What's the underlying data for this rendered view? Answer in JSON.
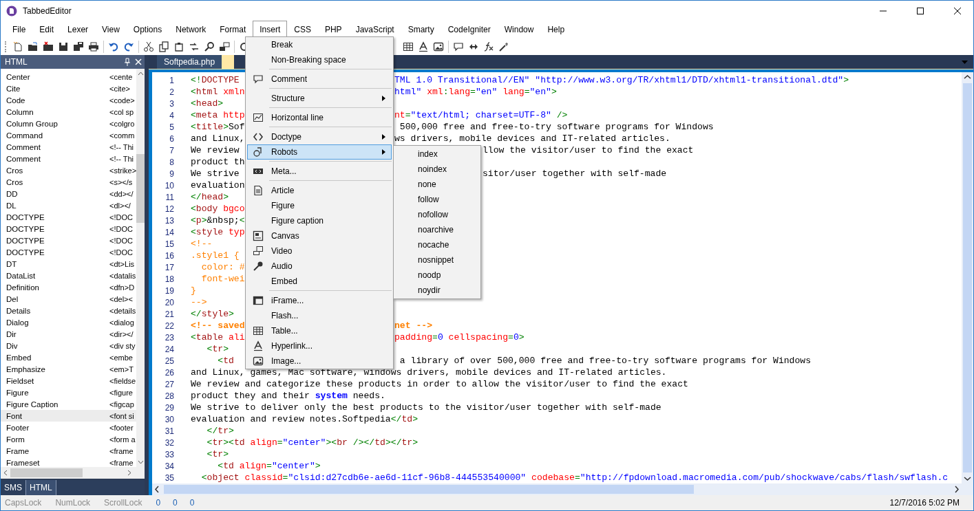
{
  "window": {
    "title": "TabbedEditor"
  },
  "menu_bar": [
    {
      "label": "File",
      "selected": false
    },
    {
      "label": "Edit",
      "selected": false
    },
    {
      "label": "Lexer",
      "selected": false
    },
    {
      "label": "View",
      "selected": false
    },
    {
      "label": "Options",
      "selected": false
    },
    {
      "label": "Network",
      "selected": false
    },
    {
      "label": "Format",
      "selected": false
    },
    {
      "label": "Insert",
      "selected": true
    },
    {
      "label": "CSS",
      "selected": false
    },
    {
      "label": "PHP",
      "selected": false
    },
    {
      "label": "JavaScript",
      "selected": false
    },
    {
      "label": "Smarty",
      "selected": false
    },
    {
      "label": "CodeIgniter",
      "selected": false
    },
    {
      "label": "Window",
      "selected": false
    },
    {
      "label": "Help",
      "selected": false
    }
  ],
  "insert_menu": [
    {
      "kind": "item",
      "label": "Break",
      "selected": false
    },
    {
      "kind": "item",
      "label": "Non-Breaking space",
      "selected": false
    },
    {
      "kind": "separator"
    },
    {
      "kind": "item",
      "label": "Comment",
      "selected": false
    },
    {
      "kind": "separator"
    },
    {
      "kind": "item",
      "label": "Structure",
      "has_submenu": true,
      "selected": false
    },
    {
      "kind": "separator"
    },
    {
      "kind": "item",
      "label": "Horizontal line",
      "selected": false
    },
    {
      "kind": "separator"
    },
    {
      "kind": "item",
      "label": "Doctype",
      "has_submenu": true,
      "selected": false
    },
    {
      "kind": "item",
      "label": "Robots",
      "has_submenu": true,
      "selected": true,
      "submenu": [
        "index",
        "noindex",
        "none",
        "follow",
        "nofollow",
        "noarchive",
        "nocache",
        "nosnippet",
        "noodp",
        "noydir"
      ]
    },
    {
      "kind": "separator"
    },
    {
      "kind": "item",
      "label": "Meta...",
      "selected": false
    },
    {
      "kind": "separator"
    },
    {
      "kind": "item",
      "label": "Article",
      "selected": false
    },
    {
      "kind": "item",
      "label": "Figure",
      "selected": false
    },
    {
      "kind": "item",
      "label": "Figure caption",
      "selected": false
    },
    {
      "kind": "item",
      "label": "Canvas",
      "selected": false
    },
    {
      "kind": "item",
      "label": "Video",
      "selected": false
    },
    {
      "kind": "item",
      "label": "Audio",
      "selected": false
    },
    {
      "kind": "item",
      "label": "Embed",
      "selected": false
    },
    {
      "kind": "separator"
    },
    {
      "kind": "item",
      "label": "iFrame...",
      "selected": false
    },
    {
      "kind": "item",
      "label": "Flash...",
      "selected": false
    },
    {
      "kind": "item",
      "label": "Table...",
      "selected": false
    },
    {
      "kind": "item",
      "label": "Hyperlink...",
      "selected": false
    },
    {
      "kind": "item",
      "label": "Image...",
      "selected": false
    }
  ],
  "side_panel": {
    "title": "HTML",
    "items": [
      {
        "name": "Center",
        "snippet": "<cente",
        "selected": false
      },
      {
        "name": "Cite",
        "snippet": "<cite>",
        "selected": false
      },
      {
        "name": "Code",
        "snippet": "<code>",
        "selected": false
      },
      {
        "name": "Column",
        "snippet": "<col sp",
        "selected": false
      },
      {
        "name": "Column Group",
        "snippet": "<colgro",
        "selected": false
      },
      {
        "name": "Command",
        "snippet": "<comm",
        "selected": false
      },
      {
        "name": "Comment",
        "snippet": "<!-- Thi",
        "selected": false
      },
      {
        "name": "Comment",
        "snippet": "<!-- Thi",
        "selected": false
      },
      {
        "name": "Cros",
        "snippet": "<strike>",
        "selected": false
      },
      {
        "name": "Cros",
        "snippet": "<s></s",
        "selected": false
      },
      {
        "name": "DD",
        "snippet": "<dd></",
        "selected": false
      },
      {
        "name": "DL",
        "snippet": "<dl></",
        "selected": false
      },
      {
        "name": "DOCTYPE",
        "snippet": "<!DOC",
        "selected": false
      },
      {
        "name": "DOCTYPE",
        "snippet": "<!DOC",
        "selected": false
      },
      {
        "name": "DOCTYPE",
        "snippet": "<!DOC",
        "selected": false
      },
      {
        "name": "DOCTYPE",
        "snippet": "<!DOC",
        "selected": false
      },
      {
        "name": "DT",
        "snippet": "<dt>Lis",
        "selected": false
      },
      {
        "name": "DataList",
        "snippet": "<datalis",
        "selected": false
      },
      {
        "name": "Definition",
        "snippet": "<dfn>D",
        "selected": false
      },
      {
        "name": "Del",
        "snippet": "<del><",
        "selected": false
      },
      {
        "name": "Details",
        "snippet": "<details",
        "selected": false
      },
      {
        "name": "Dialog",
        "snippet": "<dialog",
        "selected": false
      },
      {
        "name": "Dir",
        "snippet": "<dir></",
        "selected": false
      },
      {
        "name": "Div",
        "snippet": "<div sty",
        "selected": false
      },
      {
        "name": "Embed",
        "snippet": "<embe",
        "selected": false
      },
      {
        "name": "Emphasize",
        "snippet": "<em>T",
        "selected": false
      },
      {
        "name": "Fieldset",
        "snippet": "<fieldse",
        "selected": false
      },
      {
        "name": "Figure",
        "snippet": "<figure",
        "selected": false
      },
      {
        "name": "Figure Caption",
        "snippet": "<figcap",
        "selected": false
      },
      {
        "name": "Font",
        "snippet": "<font si",
        "selected": true
      },
      {
        "name": "Footer",
        "snippet": "<footer",
        "selected": false
      },
      {
        "name": "Form",
        "snippet": "<form a",
        "selected": false
      },
      {
        "name": "Frame",
        "snippet": "<frame",
        "selected": false
      },
      {
        "name": "Frameset",
        "snippet": "<frame",
        "selected": false
      }
    ],
    "bottom_tabs": [
      {
        "label": "SMS",
        "selected": false
      },
      {
        "label": "HTML",
        "selected": true
      }
    ]
  },
  "editor": {
    "tabs": [
      {
        "label": "Softpedia.php",
        "selected": false
      }
    ],
    "lines": [
      {
        "n": "1",
        "text": [
          {
            "kind": "punct",
            "text": "<!"
          },
          {
            "kind": "tag",
            "text": "DOCTYPE"
          }
        ],
        "after_menu": [
          {
            "kind": "value",
            "text": "TML 1.0 Transitional//EN\" \"http://www.w3.org/TR/xhtml1/DTD/xhtml1-transitional.dtd\""
          },
          {
            "kind": "punct",
            "text": ">"
          }
        ]
      },
      {
        "n": "2",
        "text": [
          {
            "kind": "punct",
            "text": "<"
          },
          {
            "kind": "tag",
            "text": "html"
          },
          {
            "kind": "attr",
            "text": " xmln"
          }
        ],
        "after_menu": [
          {
            "kind": "value",
            "text": "html\""
          },
          {
            "kind": "attr",
            "text": " xml"
          },
          {
            "kind": "punct",
            "text": ":"
          },
          {
            "kind": "attr",
            "text": "lang"
          },
          {
            "kind": "punct",
            "text": "="
          },
          {
            "kind": "value",
            "text": "\"en\""
          },
          {
            "kind": "attr",
            "text": " lang"
          },
          {
            "kind": "punct",
            "text": "="
          },
          {
            "kind": "value",
            "text": "\"en\""
          },
          {
            "kind": "punct",
            "text": ">"
          }
        ]
      },
      {
        "n": "3",
        "text": [
          {
            "kind": "punct",
            "text": "<"
          },
          {
            "kind": "tag",
            "text": "head"
          },
          {
            "kind": "punct",
            "text": ">"
          }
        ]
      },
      {
        "n": "4",
        "text": [
          {
            "kind": "punct",
            "text": "<"
          },
          {
            "kind": "tag",
            "text": "meta"
          },
          {
            "kind": "attr",
            "text": " http"
          }
        ],
        "after_menu": [
          {
            "kind": "attr",
            "text": "nt"
          },
          {
            "kind": "punct",
            "text": "="
          },
          {
            "kind": "value",
            "text": "\"text/html; charset=UTF-8\""
          },
          {
            "kind": "punct",
            "text": " />"
          }
        ]
      },
      {
        "n": "5",
        "text": [
          {
            "kind": "punct",
            "text": "<"
          },
          {
            "kind": "tag",
            "text": "title"
          },
          {
            "kind": "punct",
            "text": ">"
          },
          {
            "kind": "plain",
            "text": "Sof"
          }
        ],
        "after_menu": [
          {
            "kind": "plain",
            "text": " 500,000 free and free-to-try software programs for Windows"
          }
        ]
      },
      {
        "n": "6",
        "text": [
          {
            "kind": "plain",
            "text": "and Linux,"
          }
        ],
        "after_menu": [
          {
            "kind": "plain",
            "text": "ws drivers, mobile devices and IT-related articles."
          }
        ]
      },
      {
        "n": "7",
        "text": [
          {
            "kind": "plain",
            "text": "We review"
          }
        ],
        "after_submenu": [
          {
            "kind": "plain",
            "text": "llow the visitor/user to find the exact"
          }
        ]
      },
      {
        "n": "8",
        "text": [
          {
            "kind": "plain",
            "text": "product th"
          }
        ]
      },
      {
        "n": "9",
        "text": [
          {
            "kind": "plain",
            "text": "We strive"
          }
        ],
        "after_submenu": [
          {
            "kind": "plain",
            "text": "sitor/user together with self-made"
          }
        ]
      },
      {
        "n": "10",
        "text": [
          {
            "kind": "plain",
            "text": "evaluation"
          }
        ]
      },
      {
        "n": "11",
        "text": [
          {
            "kind": "punct",
            "text": "</"
          },
          {
            "kind": "tag",
            "text": "head"
          },
          {
            "kind": "punct",
            "text": ">"
          }
        ]
      },
      {
        "n": "12",
        "text": [
          {
            "kind": "punct",
            "text": "<"
          },
          {
            "kind": "tag",
            "text": "body"
          },
          {
            "kind": "attr",
            "text": " bgco"
          }
        ]
      },
      {
        "n": "13",
        "text": [
          {
            "kind": "punct",
            "text": "<"
          },
          {
            "kind": "tag",
            "text": "p"
          },
          {
            "kind": "punct",
            "text": ">"
          },
          {
            "kind": "plain",
            "text": "&nbsp;"
          },
          {
            "kind": "punct",
            "text": "<"
          }
        ]
      },
      {
        "n": "14",
        "text": [
          {
            "kind": "punct",
            "text": "<"
          },
          {
            "kind": "tag",
            "text": "style"
          },
          {
            "kind": "attr",
            "text": " typ"
          }
        ]
      },
      {
        "n": "15",
        "text": [
          {
            "kind": "comment",
            "text": "<!--"
          }
        ]
      },
      {
        "n": "16",
        "text": [
          {
            "kind": "comment",
            "text": ".style1 {"
          }
        ]
      },
      {
        "n": "17",
        "text": [
          {
            "kind": "comment",
            "text": "  color: #"
          }
        ]
      },
      {
        "n": "18",
        "text": [
          {
            "kind": "comment",
            "text": "  font-wei"
          }
        ]
      },
      {
        "n": "19",
        "text": [
          {
            "kind": "comment",
            "text": "}"
          }
        ]
      },
      {
        "n": "20",
        "text": [
          {
            "kind": "comment",
            "text": "-->"
          }
        ]
      },
      {
        "n": "21",
        "text": [
          {
            "kind": "punct",
            "text": "</"
          },
          {
            "kind": "tag",
            "text": "style"
          },
          {
            "kind": "punct",
            "text": ">"
          }
        ]
      },
      {
        "n": "22",
        "text": [
          {
            "kind": "comment_bold",
            "text": "<!-- saved"
          }
        ],
        "after_menu": [
          {
            "kind": "comment_bold",
            "text": "net -->"
          }
        ]
      },
      {
        "n": "23",
        "text": [
          {
            "kind": "punct",
            "text": "<"
          },
          {
            "kind": "tag",
            "text": "table"
          },
          {
            "kind": "attr",
            "text": " ali"
          }
        ],
        "after_menu": [
          {
            "kind": "attr",
            "text": "padding"
          },
          {
            "kind": "punct",
            "text": "="
          },
          {
            "kind": "value",
            "text": "0"
          },
          {
            "kind": "attr",
            "text": " cellspacing"
          },
          {
            "kind": "punct",
            "text": "="
          },
          {
            "kind": "value",
            "text": "0"
          },
          {
            "kind": "punct",
            "text": ">"
          }
        ]
      },
      {
        "n": "24",
        "text": [
          {
            "kind": "punct",
            "text": "   <"
          },
          {
            "kind": "tag",
            "text": "tr"
          },
          {
            "kind": "punct",
            "text": ">"
          }
        ]
      },
      {
        "n": "25",
        "text": [
          {
            "kind": "punct",
            "text": "     <"
          },
          {
            "kind": "tag",
            "text": "td"
          }
        ],
        "after_menu": [
          {
            "kind": "plain",
            "text": " a library of over 500,000 free and free-to-try software programs for Windows"
          }
        ]
      },
      {
        "n": "26",
        "text": [
          {
            "kind": "plain",
            "text": "and Linux, games, Mac software, windows drivers, mobile devices and IT-related articles."
          }
        ]
      },
      {
        "n": "27",
        "text": [
          {
            "kind": "plain",
            "text": "We review and categorize these products in order to allow the visitor/user to find the exact"
          }
        ]
      },
      {
        "n": "28",
        "text": [
          {
            "kind": "plain",
            "text": "product they and their "
          },
          {
            "kind": "keyword",
            "text": "system"
          },
          {
            "kind": "plain",
            "text": " needs."
          }
        ]
      },
      {
        "n": "29",
        "text": [
          {
            "kind": "plain",
            "text": "We strive to deliver only the best products to the visitor/user together with self-made"
          }
        ]
      },
      {
        "n": "30",
        "text": [
          {
            "kind": "plain",
            "text": "evaluation and review notes.Softpedia"
          },
          {
            "kind": "punct",
            "text": "</"
          },
          {
            "kind": "tag",
            "text": "td"
          },
          {
            "kind": "punct",
            "text": ">"
          }
        ]
      },
      {
        "n": "31",
        "text": [
          {
            "kind": "punct",
            "text": "   </"
          },
          {
            "kind": "tag",
            "text": "tr"
          },
          {
            "kind": "punct",
            "text": ">"
          }
        ]
      },
      {
        "n": "32",
        "text": [
          {
            "kind": "punct",
            "text": "   <"
          },
          {
            "kind": "tag",
            "text": "tr"
          },
          {
            "kind": "punct",
            "text": "><"
          },
          {
            "kind": "tag",
            "text": "td"
          },
          {
            "kind": "attr",
            "text": " align"
          },
          {
            "kind": "punct",
            "text": "="
          },
          {
            "kind": "value",
            "text": "\"center\""
          },
          {
            "kind": "punct",
            "text": "><"
          },
          {
            "kind": "tag",
            "text": "br"
          },
          {
            "kind": "punct",
            "text": " /></"
          },
          {
            "kind": "tag",
            "text": "td"
          },
          {
            "kind": "punct",
            "text": "></"
          },
          {
            "kind": "tag",
            "text": "tr"
          },
          {
            "kind": "punct",
            "text": ">"
          }
        ]
      },
      {
        "n": "33",
        "text": [
          {
            "kind": "punct",
            "text": "   <"
          },
          {
            "kind": "tag",
            "text": "tr"
          },
          {
            "kind": "punct",
            "text": ">"
          }
        ]
      },
      {
        "n": "34",
        "text": [
          {
            "kind": "punct",
            "text": "     <"
          },
          {
            "kind": "tag",
            "text": "td"
          },
          {
            "kind": "attr",
            "text": " align"
          },
          {
            "kind": "punct",
            "text": "="
          },
          {
            "kind": "value",
            "text": "\"center\""
          },
          {
            "kind": "punct",
            "text": ">"
          }
        ]
      },
      {
        "n": "35",
        "text": [
          {
            "kind": "punct",
            "text": "  <"
          },
          {
            "kind": "tag",
            "text": "object"
          },
          {
            "kind": "attr",
            "text": " classid"
          },
          {
            "kind": "punct",
            "text": "="
          },
          {
            "kind": "value",
            "text": "\"clsid:d27cdb6e-ae6d-11cf-96b8-444553540000\""
          },
          {
            "kind": "attr",
            "text": " codebase"
          },
          {
            "kind": "punct",
            "text": "="
          },
          {
            "kind": "value",
            "text": "\"http://fpdownload.macromedia.com/pub/shockwave/cabs/flash/swflash.c"
          }
        ]
      }
    ]
  },
  "status_bar": {
    "locks": [
      {
        "label": "CapsLock",
        "on": false
      },
      {
        "label": "NumLock",
        "on": false
      },
      {
        "label": "ScrollLock",
        "on": false
      }
    ],
    "counters": [
      "0",
      "0",
      "0"
    ],
    "datetime": "12/7/2016 5:02 PM"
  }
}
